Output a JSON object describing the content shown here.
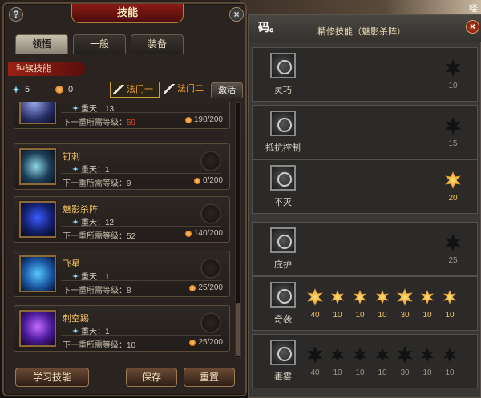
{
  "corner_text": "喽",
  "left": {
    "title": "技能",
    "help_icon": "?",
    "close_icon": "×",
    "tabs": [
      "领悟",
      "一般",
      "装备"
    ],
    "section": "种族技能",
    "points_blue": "5",
    "points_orange": "0",
    "path1": "法门一",
    "path2": "法门二",
    "activate": "激活",
    "skills": [
      {
        "name": "",
        "level": "重天：13",
        "need_label": "下一重所需等级：",
        "need": "59",
        "cost": "190/200",
        "icon": "skill-icon-top"
      },
      {
        "name": "钉刺",
        "level": "重天：1",
        "need_label": "下一重所需等级：",
        "need": "9",
        "cost": "0/200",
        "icon": "skill-icon-spike"
      },
      {
        "name": "魅影杀阵",
        "level": "重天：12",
        "need_label": "下一重所需等级：",
        "need": "52",
        "cost": "140/200",
        "icon": "skill-icon-phantom"
      },
      {
        "name": "飞星",
        "level": "重天：1",
        "need_label": "下一重所需等级：",
        "need": "8",
        "cost": "25/200",
        "icon": "skill-icon-star"
      },
      {
        "name": "刺空踢",
        "level": "重天：1",
        "need_label": "下一重所需等级：",
        "need": "10",
        "cost": "25/200",
        "icon": "skill-icon-kick"
      }
    ],
    "btn_learn": "学习技能",
    "btn_save": "保存",
    "btn_reset": "重置"
  },
  "right": {
    "ma": "码。",
    "title": "精修技能（魅影杀阵）",
    "close_icon": "×",
    "rows": [
      {
        "name": "灵巧",
        "nodes": [
          {
            "v": "10",
            "lit": false,
            "big": true
          }
        ]
      },
      {
        "name": "抵抗控制",
        "nodes": [
          {
            "v": "15",
            "lit": false,
            "big": true
          }
        ]
      },
      {
        "name": "不灭",
        "nodes": [
          {
            "v": "20",
            "lit": true,
            "big": true
          }
        ]
      },
      {
        "name": "庇护",
        "nodes": [
          {
            "v": "25",
            "lit": false,
            "big": true
          }
        ]
      },
      {
        "name": "奇袭",
        "nodes": [
          {
            "v": "40",
            "lit": true,
            "big": true
          },
          {
            "v": "10",
            "lit": true
          },
          {
            "v": "10",
            "lit": true
          },
          {
            "v": "10",
            "lit": true
          },
          {
            "v": "30",
            "lit": true,
            "big": true
          },
          {
            "v": "10",
            "lit": true
          },
          {
            "v": "10",
            "lit": true
          }
        ]
      },
      {
        "name": "毒雾",
        "nodes": [
          {
            "v": "40",
            "lit": false,
            "big": true
          },
          {
            "v": "10",
            "lit": false
          },
          {
            "v": "10",
            "lit": false
          },
          {
            "v": "10",
            "lit": false
          },
          {
            "v": "30",
            "lit": false,
            "big": true
          },
          {
            "v": "10",
            "lit": false
          },
          {
            "v": "10",
            "lit": false
          }
        ]
      }
    ]
  },
  "colors": {
    "accent_red": "#9a2016",
    "gold": "#f0c060",
    "lit_star": "#e06a00"
  }
}
